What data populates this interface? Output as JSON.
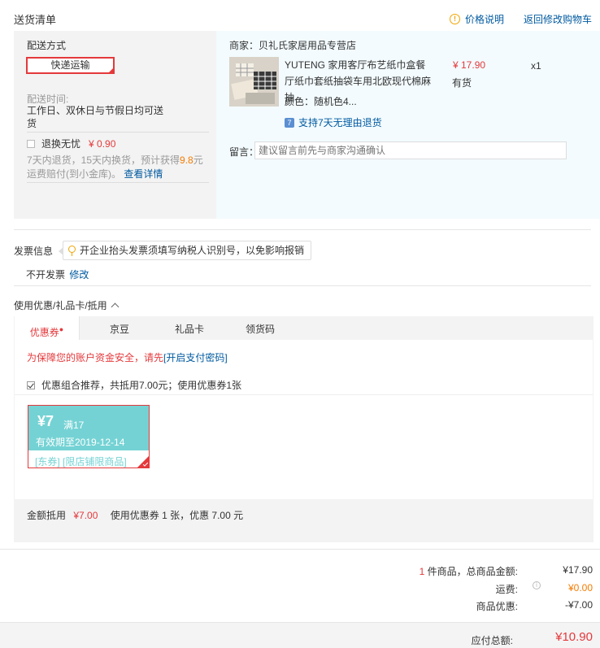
{
  "header": {
    "title": "送货清单",
    "price_note": "价格说明",
    "back_to_cart": "返回修改购物车"
  },
  "shipping": {
    "method_label": "配送方式",
    "method_value": "快递运输",
    "time_label": "配送时间:",
    "time_value": "工作日、双休日与节假日均可送货",
    "no_return_label": "退换无忧",
    "no_return_price": "¥ 0.90",
    "no_return_desc_1": "7天内退货，15天内换货，预计获得",
    "no_return_desc_highlight": "9.8",
    "no_return_desc_2": "元运费赔付(到小金库)。",
    "details_link": "查看详情"
  },
  "product": {
    "merchant": "商家：贝礼氏家居用品专营店",
    "name": "YUTENG 家用客厅布艺纸巾盒餐厅纸巾套纸抽袋车用北欧现代棉麻抽",
    "price": "¥ 17.90",
    "stock": "有货",
    "qty": "x1",
    "color": "颜色：随机色4...",
    "return_policy": "支持7天无理由退货",
    "message_label": "留言：",
    "message_placeholder": "建议留言前先与商家沟通确认"
  },
  "invoice": {
    "label": "发票信息",
    "tip": "开企业抬头发票须填写纳税人识别号，以免影响报销",
    "value": "不开发票",
    "edit": "修改"
  },
  "coupons": {
    "section_label": "使用优惠/礼品卡/抵用",
    "tabs": [
      "优惠券",
      "京豆",
      "礼品卡",
      "领货码"
    ],
    "warning_prefix": "为保障您的账户资金安全，请先",
    "warning_link": "[开启支付密码]",
    "combo_text": "优惠组合推荐，共抵用7.00元；使用优惠券1张",
    "coupon": {
      "amount": "¥7",
      "condition": "满17",
      "valid": "有效期至2019-12-14",
      "tags": "[东券] [限店铺限商品]"
    },
    "summary_label": "金额抵用",
    "summary_amount": "¥7.00",
    "summary_text": "使用优惠券 1 张，优惠 7.00 元"
  },
  "totals": {
    "items_count": "1",
    "items_label": " 件商品，总商品金额:",
    "items_amount": "¥17.90",
    "shipping_label": "运费:",
    "shipping_amount": "¥0.00",
    "discount_label": "商品优惠:",
    "discount_amount": "-¥7.00",
    "payable_label": "应付总额:",
    "payable_amount": "¥10.90"
  }
}
